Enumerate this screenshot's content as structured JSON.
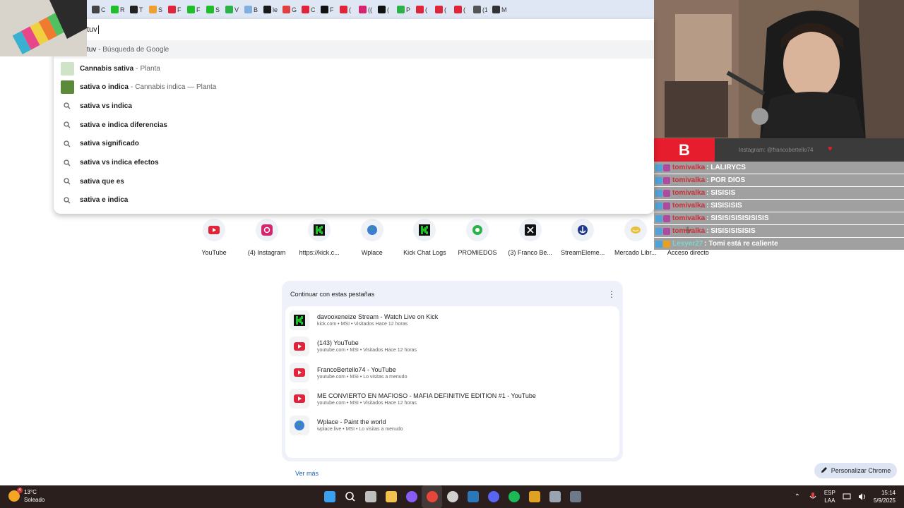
{
  "tabs": [
    {
      "icon": "pin-icon",
      "color": "#444444",
      "title": "C"
    },
    {
      "icon": "kick-icon",
      "color": "#1fbf2a",
      "title": "R"
    },
    {
      "icon": "tab-icon",
      "color": "#222222",
      "title": "T"
    },
    {
      "icon": "emoji-icon",
      "color": "#f0a030",
      "title": "S"
    },
    {
      "icon": "youtube-icon",
      "color": "#e0243a",
      "title": "F"
    },
    {
      "icon": "kick-icon",
      "color": "#1fbf2a",
      "title": "F"
    },
    {
      "icon": "kick-icon",
      "color": "#1fbf2a",
      "title": "S"
    },
    {
      "icon": "w-icon",
      "color": "#2bb34a",
      "title": "V"
    },
    {
      "icon": "flag-icon",
      "color": "#7fb0e0",
      "title": "B"
    },
    {
      "icon": "kick-icon",
      "color": "#1a1a1a",
      "title": "le"
    },
    {
      "icon": "maps-icon",
      "color": "#e04040",
      "title": "G"
    },
    {
      "icon": "youtube-icon",
      "color": "#e0243a",
      "title": "C"
    },
    {
      "icon": "tiktok-icon",
      "color": "#111111",
      "title": "F"
    },
    {
      "icon": "youtube-icon",
      "color": "#e0243a",
      "title": "("
    },
    {
      "icon": "instagram-icon",
      "color": "#d6246e",
      "title": "(("
    },
    {
      "icon": "x-icon",
      "color": "#111111",
      "title": "("
    },
    {
      "icon": "ball-icon",
      "color": "#2bb34a",
      "title": "P"
    },
    {
      "icon": "youtube-icon",
      "color": "#e0243a",
      "title": "("
    },
    {
      "icon": "youtube-icon",
      "color": "#e0243a",
      "title": "("
    },
    {
      "icon": "youtube-icon",
      "color": "#e0243a",
      "title": "("
    },
    {
      "icon": "sound-icon",
      "color": "#555555",
      "title": "(1"
    },
    {
      "icon": "tab-icon",
      "color": "#333333",
      "title": "M"
    }
  ],
  "omnibox": {
    "input_value": "tuv",
    "first": {
      "query": "tuv",
      "suffix": "Búsqueda de Google"
    },
    "suggestions": [
      {
        "kind": "entity",
        "bold": "Cannabis sativa",
        "muted": "Planta",
        "thumb_color": "#cfe3c9"
      },
      {
        "kind": "entity",
        "bold": "sativa o indica",
        "muted": "Cannabis indica — Planta",
        "thumb_color": "#5a8a3a"
      },
      {
        "kind": "search",
        "bold": "sativa vs indica",
        "muted": ""
      },
      {
        "kind": "search",
        "bold": "sativa e indica diferencias",
        "muted": ""
      },
      {
        "kind": "search",
        "bold": "sativa significado",
        "muted": ""
      },
      {
        "kind": "search",
        "bold": "sativa vs indica efectos",
        "muted": ""
      },
      {
        "kind": "search",
        "bold": "sativa que es",
        "muted": ""
      },
      {
        "kind": "search",
        "bold": "sativa e indica",
        "muted": ""
      }
    ]
  },
  "shortcuts": [
    {
      "label": "YouTube",
      "icon": "youtube-icon",
      "color": "#e0243a"
    },
    {
      "label": "(4) Instagram",
      "icon": "instagram-icon",
      "color": "#d6246e"
    },
    {
      "label": "https://kick.c...",
      "icon": "kick-icon",
      "color": "#1fbf2a"
    },
    {
      "label": "Wplace",
      "icon": "globe-icon",
      "color": "#3b7dd8"
    },
    {
      "label": "Kick Chat Logs",
      "icon": "kick-icon",
      "color": "#1fbf2a"
    },
    {
      "label": "PROMIEDOS",
      "icon": "ball-icon",
      "color": "#2bb34a"
    },
    {
      "label": "(3) Franco Be...",
      "icon": "x-icon",
      "color": "#111111"
    },
    {
      "label": "StreamEleme...",
      "icon": "streamelements-icon",
      "color": "#1f3a8a"
    },
    {
      "label": "Mercado Libr...",
      "icon": "mercadolibre-icon",
      "color": "#e7c23a"
    },
    {
      "label": "Acceso directo",
      "icon": "add-icon",
      "color": "#ffffff"
    }
  ],
  "continue_card": {
    "title": "Continuar con estas pestañas",
    "items": [
      {
        "title": "davooxeneize Stream - Watch Live on Kick",
        "subtitle": "kick.com • MSI • Visitados Hace 12 horas",
        "icon": "kick-icon",
        "color": "#1fbf2a"
      },
      {
        "title": "(143) YouTube",
        "subtitle": "youtube.com • MSI • Visitados Hace 12 horas",
        "icon": "youtube-icon",
        "color": "#e0243a"
      },
      {
        "title": "FrancoBertello74 - YouTube",
        "subtitle": "youtube.com • MSI • Lo visitas a menudo",
        "icon": "youtube-icon",
        "color": "#e0243a"
      },
      {
        "title": "ME CONVIERTO EN MAFIOSO - MAFIA DEFINITIVE EDITION #1 - YouTube",
        "subtitle": "youtube.com • MSI • Visitados Hace 12 horas",
        "icon": "youtube-icon",
        "color": "#e0243a"
      },
      {
        "title": "Wplace - Paint the world",
        "subtitle": "wplace.live • MSI • Lo visitas a menudo",
        "icon": "globe-icon",
        "color": "#3b7dd8"
      }
    ],
    "more_label": "Ver más"
  },
  "customize_label": "Personalizar Chrome",
  "stream": {
    "banner_text": "Instagram: @francobertello74",
    "chat": [
      {
        "user": "tomivalka",
        "message": ": LALIRYCS",
        "alt": false
      },
      {
        "user": "tomivalka",
        "message": ": POR DIOS",
        "alt": false
      },
      {
        "user": "tomivalka",
        "message": ": SISISIS",
        "alt": false
      },
      {
        "user": "tomivalka",
        "message": ": SISISISIS",
        "alt": false
      },
      {
        "user": "tomivalka",
        "message": ": SISISISISISISISIS",
        "alt": false
      },
      {
        "user": "tomivalka",
        "message": ": SISISISISISIS",
        "alt": false
      },
      {
        "user": "Lesyer27",
        "message": ": Tomi está re caliente",
        "alt": true
      }
    ]
  },
  "taskbar": {
    "weather_temp": "13°C",
    "weather_desc": "Soleado",
    "weather_badge": "4",
    "apps": [
      {
        "icon": "windows-icon",
        "color": "#3aa0f0"
      },
      {
        "icon": "search-icon",
        "color": "#ffffff"
      },
      {
        "icon": "task-view-icon",
        "color": "#bfbfbf"
      },
      {
        "icon": "folder-icon",
        "color": "#f2c14e"
      },
      {
        "icon": "app-purple-icon",
        "color": "#8a5cf6"
      },
      {
        "icon": "chrome-icon",
        "color": "#e8453c"
      },
      {
        "icon": "obs-icon",
        "color": "#d0d0d0"
      },
      {
        "icon": "steam-icon",
        "color": "#2a78b8"
      },
      {
        "icon": "discord-icon",
        "color": "#5865f2"
      },
      {
        "icon": "spotify-icon",
        "color": "#1db954"
      },
      {
        "icon": "torch-icon",
        "color": "#e0a020"
      },
      {
        "icon": "settings-icon",
        "color": "#9aa4b0"
      },
      {
        "icon": "calculator-icon",
        "color": "#6c7a8a"
      }
    ],
    "lang_top": "ESP",
    "lang_bottom": "LAA",
    "time": "15:14",
    "date": "5/9/2025"
  }
}
